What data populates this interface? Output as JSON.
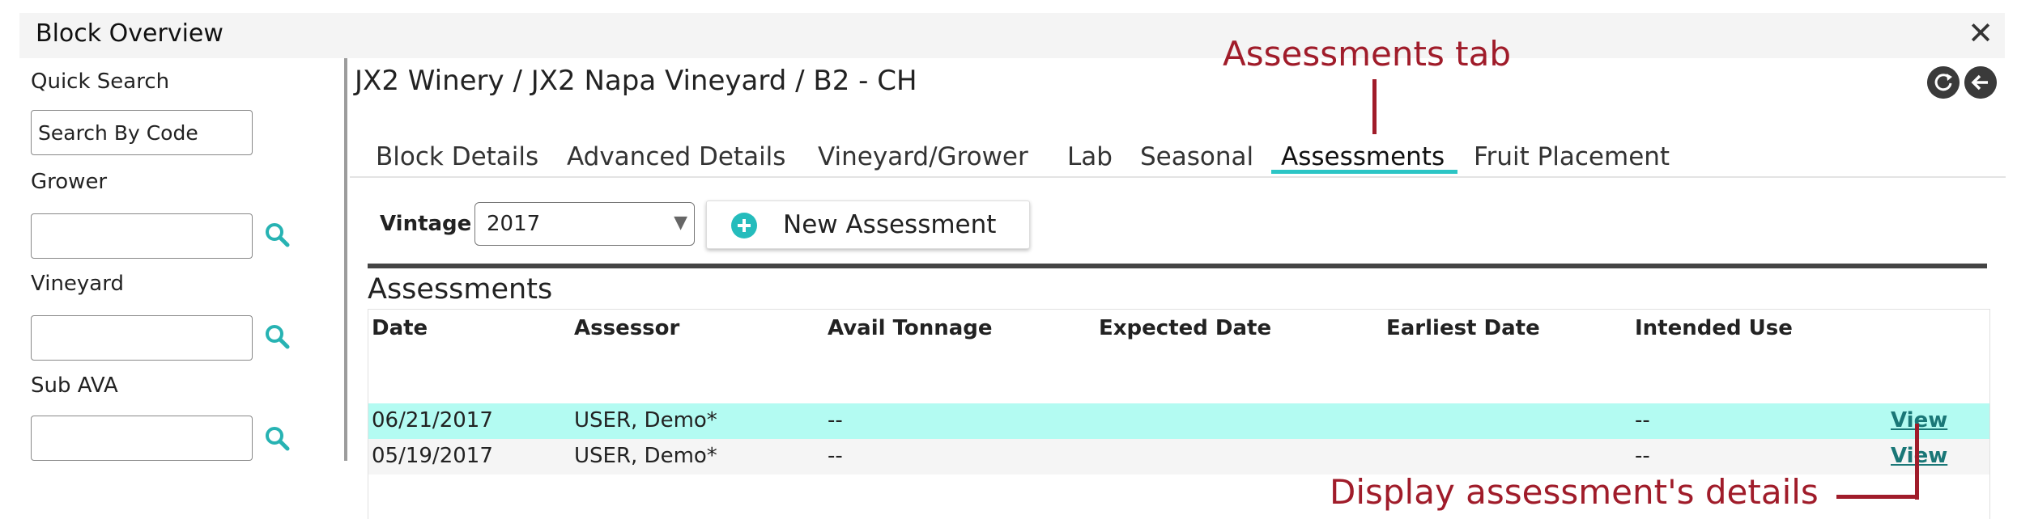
{
  "window": {
    "title": "Block Overview"
  },
  "sidebar": {
    "quick_search_label": "Quick Search",
    "quick_search_placeholder": "Search By Code",
    "grower_label": "Grower",
    "vineyard_label": "Vineyard",
    "sub_ava_label": "Sub AVA"
  },
  "header": {
    "breadcrumb": "JX2 Winery / JX2 Napa Vineyard / B2 - CH"
  },
  "tabs": [
    {
      "label": "Block Details"
    },
    {
      "label": "Advanced Details"
    },
    {
      "label": "Vineyard/Grower"
    },
    {
      "label": "Lab"
    },
    {
      "label": "Seasonal"
    },
    {
      "label": "Assessments",
      "active": true
    },
    {
      "label": "Fruit Placement"
    }
  ],
  "toolbar": {
    "vintage_label": "Vintage",
    "vintage_value": "2017",
    "new_assessment_label": "New Assessment"
  },
  "assessments": {
    "title": "Assessments",
    "columns": [
      "Date",
      "Assessor",
      "Avail Tonnage",
      "Expected Date",
      "Earliest Date",
      "Intended Use"
    ],
    "rows": [
      {
        "date": "06/21/2017",
        "assessor": "USER, Demo*",
        "avail_tonnage": "--",
        "expected_date": "",
        "earliest_date": "",
        "intended_use": "--",
        "action": "View",
        "selected": true
      },
      {
        "date": "05/19/2017",
        "assessor": "USER, Demo*",
        "avail_tonnage": "--",
        "expected_date": "",
        "earliest_date": "",
        "intended_use": "--",
        "action": "View",
        "selected": false
      }
    ]
  },
  "annotations": {
    "tab_callout": "Assessments tab",
    "view_callout": "Display assessment's details"
  },
  "colors": {
    "accent": "#2cc5c5",
    "selected_row": "#b3fbf2",
    "link": "#1a7777",
    "annotation": "#a01c2a"
  }
}
